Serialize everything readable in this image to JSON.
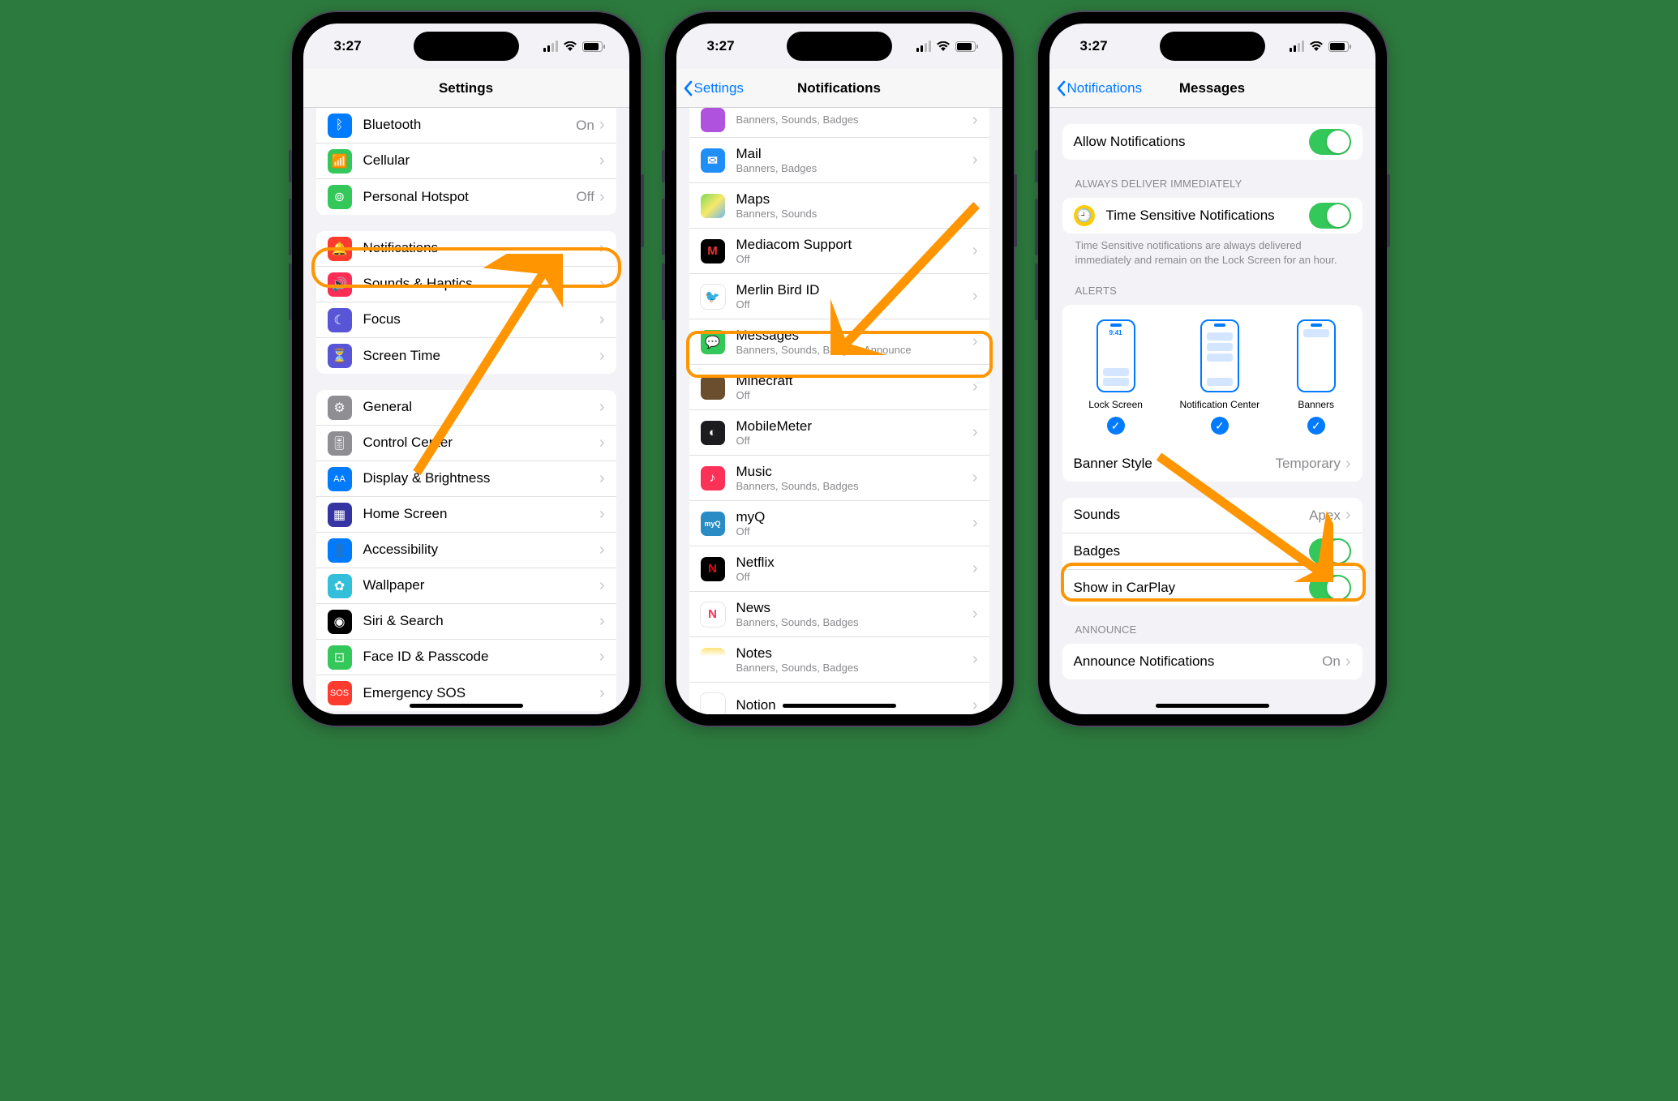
{
  "status": {
    "time": "3:27"
  },
  "phone1": {
    "title": "Settings",
    "group1": [
      {
        "icon": "bluetooth",
        "bg": "#007aff",
        "label": "Bluetooth",
        "value": "On"
      },
      {
        "icon": "cellular",
        "bg": "#34c759",
        "label": "Cellular",
        "value": ""
      },
      {
        "icon": "hotspot",
        "bg": "#34c759",
        "label": "Personal Hotspot",
        "value": "Off"
      }
    ],
    "group2": [
      {
        "icon": "bell",
        "bg": "#ff3b30",
        "label": "Notifications"
      },
      {
        "icon": "speaker",
        "bg": "#ff2d55",
        "label": "Sounds & Haptics"
      },
      {
        "icon": "moon",
        "bg": "#5856d6",
        "label": "Focus"
      },
      {
        "icon": "hourglass",
        "bg": "#5856d6",
        "label": "Screen Time"
      }
    ],
    "group3": [
      {
        "icon": "gear",
        "bg": "#8e8e93",
        "label": "General"
      },
      {
        "icon": "switches",
        "bg": "#8e8e93",
        "label": "Control Center"
      },
      {
        "icon": "AA",
        "bg": "#007aff",
        "label": "Display & Brightness"
      },
      {
        "icon": "grid",
        "bg": "#3634a3",
        "label": "Home Screen"
      },
      {
        "icon": "person",
        "bg": "#007aff",
        "label": "Accessibility"
      },
      {
        "icon": "flower",
        "bg": "#33beda",
        "label": "Wallpaper"
      },
      {
        "icon": "siri",
        "bg": "#000",
        "label": "Siri & Search"
      },
      {
        "icon": "faceid",
        "bg": "#34c759",
        "label": "Face ID & Passcode"
      },
      {
        "icon": "sos",
        "bg": "#ff3b30",
        "label": "Emergency SOS"
      }
    ]
  },
  "phone2": {
    "back": "Settings",
    "title": "Notifications",
    "apps": [
      {
        "name": "",
        "sub": "Banners, Sounds, Badges",
        "bg": "#af52de",
        "partial": true
      },
      {
        "name": "Mail",
        "sub": "Banners, Badges",
        "bg": "#1f8ef7",
        "letter": "✉"
      },
      {
        "name": "Maps",
        "sub": "Banners, Sounds",
        "bg": "linear-gradient(135deg,#7fd858,#f7e96a,#6fb8f0)",
        "letter": ""
      },
      {
        "name": "Mediacom Support",
        "sub": "Off",
        "bg": "#000",
        "letter": "M",
        "color": "#e33"
      },
      {
        "name": "Merlin Bird ID",
        "sub": "Off",
        "bg": "#fff",
        "letter": "🐦",
        "border": true
      },
      {
        "name": "Messages",
        "sub": "Banners, Sounds, Badges, Announce",
        "bg": "#34c759",
        "letter": "💬"
      },
      {
        "name": "Minecraft",
        "sub": "Off",
        "bg": "#6b4e2e",
        "letter": ""
      },
      {
        "name": "MobileMeter",
        "sub": "Off",
        "bg": "#1c1c1e",
        "letter": "◐",
        "color": "#fff"
      },
      {
        "name": "Music",
        "sub": "Banners, Sounds, Badges",
        "bg": "#fc3158",
        "letter": "♪"
      },
      {
        "name": "myQ",
        "sub": "Off",
        "bg": "#2a8cc4",
        "letter": "myQ",
        "small": true
      },
      {
        "name": "Netflix",
        "sub": "Off",
        "bg": "#000",
        "letter": "N",
        "color": "#e50914"
      },
      {
        "name": "News",
        "sub": "Banners, Sounds, Badges",
        "bg": "#fff",
        "letter": "N",
        "color": "#ff2d55",
        "border": true
      },
      {
        "name": "Notes",
        "sub": "Banners, Sounds, Badges",
        "bg": "linear-gradient(#fde37a,#fff 35%)",
        "letter": ""
      },
      {
        "name": "Notion",
        "sub": "",
        "bg": "#fff",
        "letter": "N",
        "border": true,
        "partial_bottom": true
      }
    ]
  },
  "phone3": {
    "back": "Notifications",
    "title": "Messages",
    "allow": "Allow Notifications",
    "deliver_header": "ALWAYS DELIVER IMMEDIATELY",
    "time_sensitive": "Time Sensitive Notifications",
    "deliver_footer": "Time Sensitive notifications are always delivered immediately and remain on the Lock Screen for an hour.",
    "alerts_header": "ALERTS",
    "alert_options": [
      "Lock Screen",
      "Notification Center",
      "Banners"
    ],
    "alert_time": "9:41",
    "banner_style_label": "Banner Style",
    "banner_style_value": "Temporary",
    "sounds_label": "Sounds",
    "sounds_value": "Apex",
    "badges_label": "Badges",
    "carplay_label": "Show in CarPlay",
    "announce_header": "ANNOUNCE",
    "announce_label": "Announce Notifications",
    "announce_value": "On"
  }
}
